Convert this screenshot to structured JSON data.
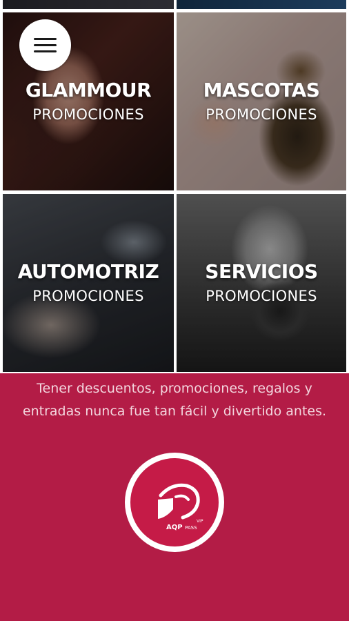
{
  "menu": {
    "icon": "hamburger-menu-icon"
  },
  "tiles": [
    {
      "title": "GLAMMOUR",
      "subtitle": "PROMOCIONES"
    },
    {
      "title": "MASCOTAS",
      "subtitle": "PROMOCIONES"
    },
    {
      "title": "AUTOMOTRIZ",
      "subtitle": "PROMOCIONES"
    },
    {
      "title": "SERVICIOS",
      "subtitle": "PROMOCIONES"
    }
  ],
  "footer": {
    "tagline": "Tener descuentos, promociones, regalos y entradas nunca fue tan fácil y divertido antes.",
    "logo": {
      "brand": "AQP",
      "pass": "PASS",
      "vip": "VIP"
    }
  },
  "colors": {
    "accent": "#b31c46",
    "logo_red": "#c51b47",
    "text_light": "#f3d6de"
  }
}
